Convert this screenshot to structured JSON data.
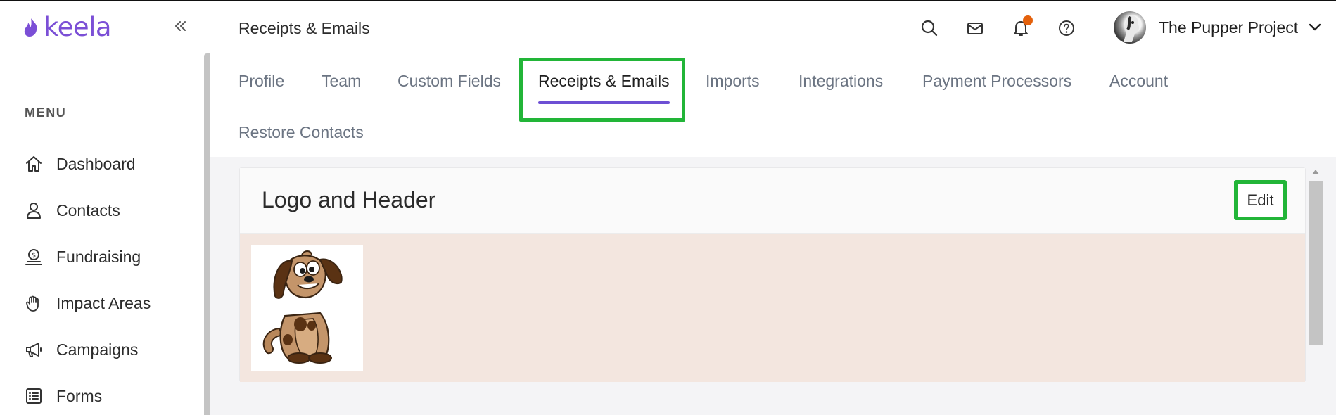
{
  "app": {
    "logo_text": "keela",
    "brand_color": "#7b4fd6"
  },
  "sidebar": {
    "menu_label": "MENU",
    "items": [
      {
        "label": "Dashboard",
        "icon": "home-icon"
      },
      {
        "label": "Contacts",
        "icon": "user-icon"
      },
      {
        "label": "Fundraising",
        "icon": "dollar-hand-icon"
      },
      {
        "label": "Impact Areas",
        "icon": "hand-heart-icon"
      },
      {
        "label": "Campaigns",
        "icon": "megaphone-icon"
      },
      {
        "label": "Forms",
        "icon": "list-icon"
      }
    ]
  },
  "header": {
    "title": "Receipts & Emails",
    "org_name": "The Pupper Project",
    "notification_color": "#e4610c"
  },
  "tabs": [
    {
      "label": "Profile"
    },
    {
      "label": "Team"
    },
    {
      "label": "Custom Fields"
    },
    {
      "label": "Receipts & Emails",
      "active": true
    },
    {
      "label": "Imports"
    },
    {
      "label": "Integrations"
    },
    {
      "label": "Payment Processors"
    },
    {
      "label": "Account"
    },
    {
      "label": "Restore Contacts"
    }
  ],
  "section": {
    "title": "Logo and Header",
    "edit_label": "Edit",
    "highlight_color": "#22b538",
    "header_bg_color": "#f3e6df",
    "logo_image": "cartoon-dog-logo"
  }
}
